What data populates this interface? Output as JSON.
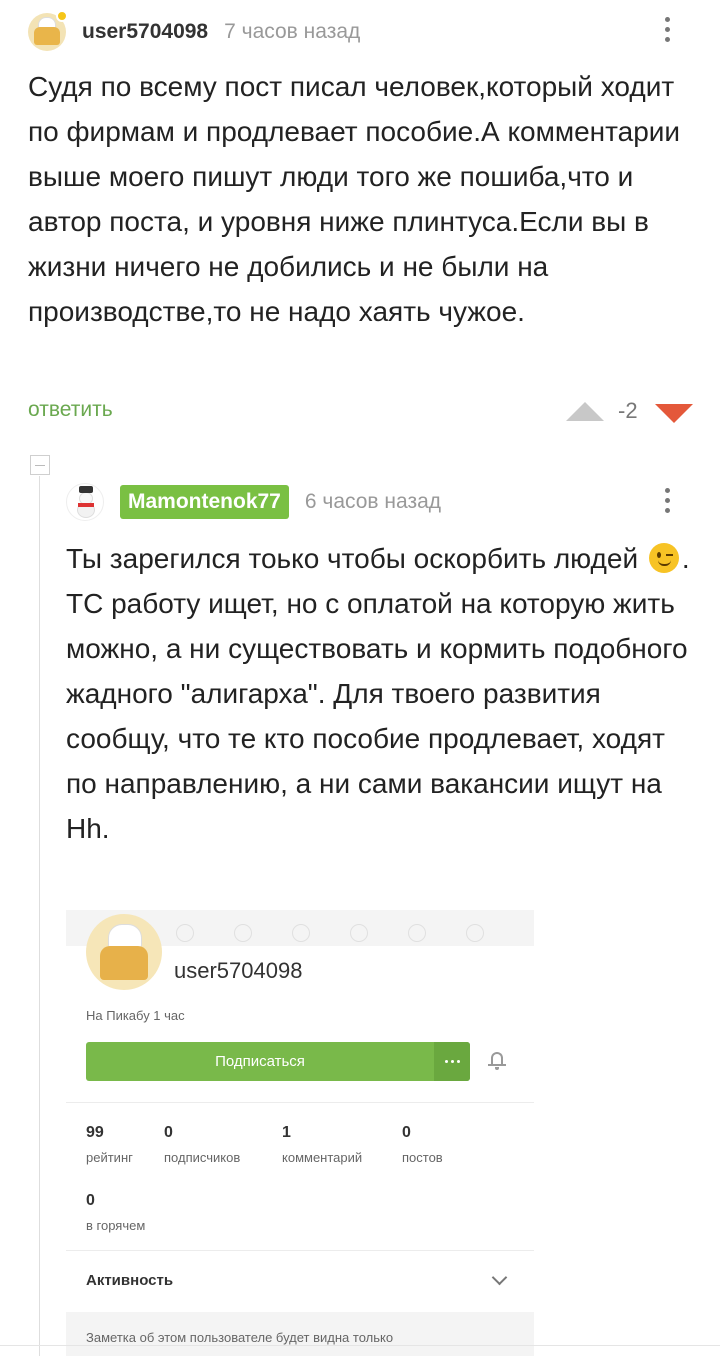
{
  "comment1": {
    "username": "user5704098",
    "time": "7 часов назад",
    "body": "Судя по всему пост писал человек,который ходит по фирмам и продлевает пособие.А комментарии выше моего пишут люди того же пошиба,что и автор поста, и уровня ниже плинтуса.Если вы в жизни ничего не добились и не были на производстве,то не надо хаять чужое.",
    "reply_label": "ответить",
    "score": "-2"
  },
  "comment2": {
    "username": "Mamontenok77",
    "time": "6 часов назад",
    "body_part1": "Ты зарегился тоько чтобы оскорбить людей",
    "body_part2": ". ТС работу ищет, но с оплатой на которую жить можно, а ни существовать и кормить подобного жадного \"алигарха\". Для твоего развития сообщу, что те кто пособие продлевает, ходят по направлению, а ни сами вакансии ищут на Hh."
  },
  "embed": {
    "username": "user5704098",
    "since": "На Пикабу 1 час",
    "subscribe_label": "Подписаться",
    "stats": [
      {
        "value": "99",
        "label": "рейтинг"
      },
      {
        "value": "0",
        "label": "подписчиков"
      },
      {
        "value": "1",
        "label": "комментарий"
      },
      {
        "value": "0",
        "label": "постов"
      },
      {
        "value": "0",
        "label": "в горячем"
      }
    ],
    "activity_label": "Активность",
    "note_text": "Заметка об этом пользователе будет видна только"
  },
  "colors": {
    "accent_green": "#7ac043",
    "downvote_red": "#e4583a"
  }
}
